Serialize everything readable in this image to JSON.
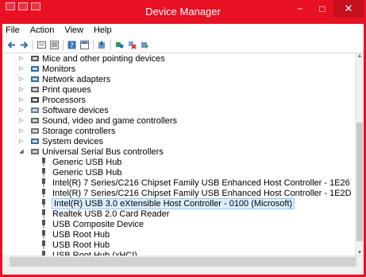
{
  "window": {
    "title": "Device Manager",
    "buttons": {
      "minimize": "−",
      "maximize": "□",
      "close": "✕"
    }
  },
  "menu": [
    "File",
    "Action",
    "View",
    "Help"
  ],
  "toolbar": [
    "back-icon",
    "forward-icon",
    "properties-icon",
    "show-hide-icon",
    "help-icon",
    "console-icon",
    "update-driver-icon",
    "uninstall-icon",
    "scan-hardware-icon"
  ],
  "tree": {
    "categories": [
      {
        "label": "Mice and other pointing devices",
        "icon": "mouse-icon",
        "color": "#556"
      },
      {
        "label": "Monitors",
        "icon": "monitor-icon",
        "color": "#2d6da3"
      },
      {
        "label": "Network adapters",
        "icon": "network-icon",
        "color": "#2c6e9a"
      },
      {
        "label": "Print queues",
        "icon": "printer-icon",
        "color": "#666"
      },
      {
        "label": "Processors",
        "icon": "processor-icon",
        "color": "#444"
      },
      {
        "label": "Software devices",
        "icon": "software-icon",
        "color": "#5f7ea0"
      },
      {
        "label": "Sound, video and game controllers",
        "icon": "speaker-icon",
        "color": "#666"
      },
      {
        "label": "Storage controllers",
        "icon": "storage-icon",
        "color": "#777"
      },
      {
        "label": "System devices",
        "icon": "system-icon",
        "color": "#3f70a8"
      }
    ],
    "expanded_category": {
      "label": "Universal Serial Bus controllers",
      "icon": "usb-controller-icon"
    },
    "usb_devices": [
      "Generic USB Hub",
      "Generic USB Hub",
      "Intel(R) 7 Series/C216 Chipset Family USB Enhanced Host Controller - 1E26",
      "Intel(R) 7 Series/C216 Chipset Family USB Enhanced Host Controller - 1E2D",
      "Intel(R) USB 3.0 eXtensible Host Controller - 0100 (Microsoft)",
      "Realtek USB 2.0 Card Reader",
      "USB Composite Device",
      "USB Root Hub",
      "USB Root Hub",
      "USB Root Hub (xHCI)"
    ],
    "selected_index": 4
  },
  "colors": {
    "accent": "#e81123",
    "selection": "#ddeeff",
    "selection_border": "#99c9ef"
  }
}
